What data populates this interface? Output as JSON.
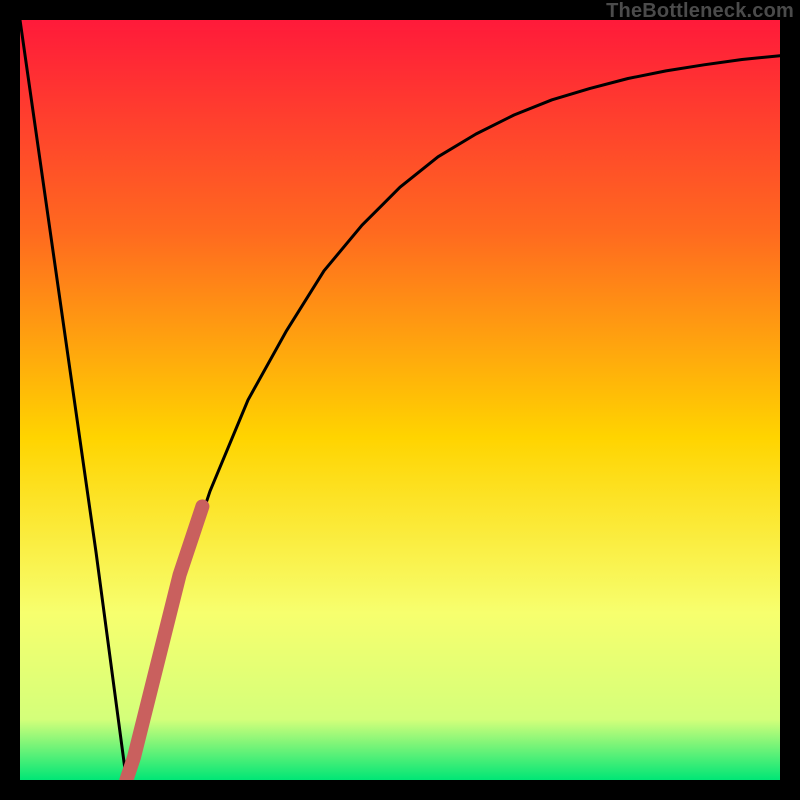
{
  "watermark": "TheBottleneck.com",
  "colors": {
    "gradient_top": "#ff1a3a",
    "gradient_upper": "#ff6a1f",
    "gradient_mid": "#ffd400",
    "gradient_lower": "#f7ff6e",
    "gradient_glow": "#d4ff7a",
    "gradient_bottom": "#00e676",
    "curve": "#000000",
    "highlight": "#c9605e",
    "frame": "#000000"
  },
  "chart_data": {
    "type": "line",
    "title": "",
    "xlabel": "",
    "ylabel": "",
    "xlim": [
      0,
      100
    ],
    "ylim": [
      0,
      100
    ],
    "grid": false,
    "legend": false,
    "annotations": [
      "TheBottleneck.com"
    ],
    "series": [
      {
        "name": "main-curve",
        "x": [
          0,
          5,
          10,
          14,
          15,
          20,
          25,
          30,
          35,
          40,
          45,
          50,
          55,
          60,
          65,
          70,
          75,
          80,
          85,
          90,
          95,
          100
        ],
        "y": [
          100,
          65,
          30,
          0,
          3,
          23,
          38,
          50,
          59,
          67,
          73,
          78,
          82,
          85,
          87.5,
          89.5,
          91,
          92.3,
          93.3,
          94.1,
          94.8,
          95.3
        ]
      },
      {
        "name": "highlight-segment",
        "x": [
          14,
          15,
          18,
          21,
          24
        ],
        "y": [
          0,
          3,
          15,
          27,
          36
        ]
      }
    ]
  }
}
